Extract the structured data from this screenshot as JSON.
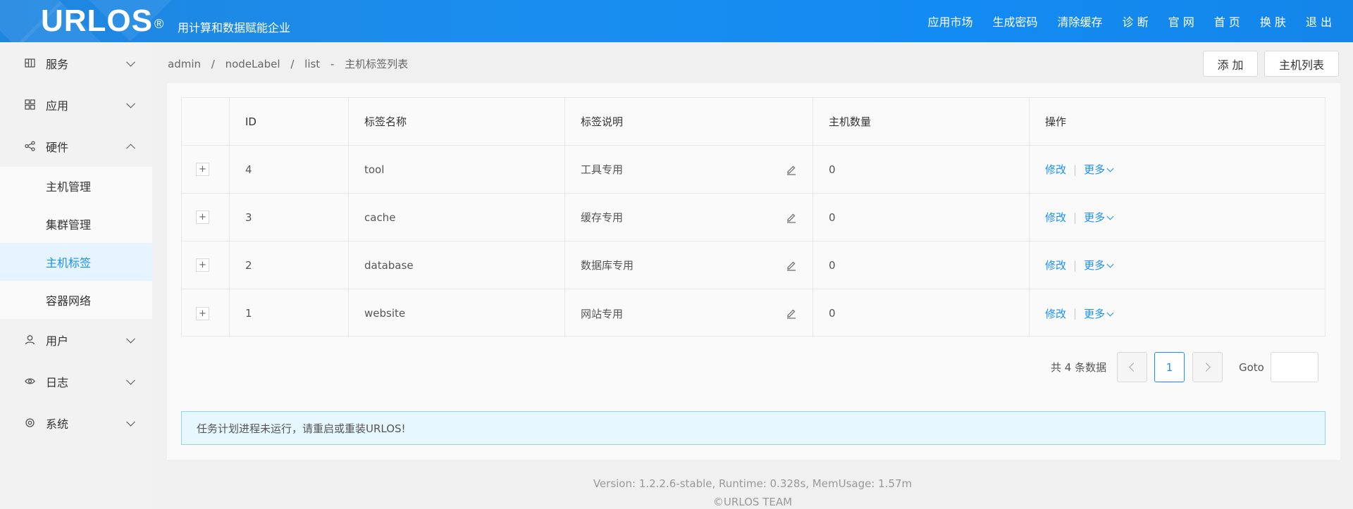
{
  "header": {
    "logo": "URLOS",
    "logo_mark": "®",
    "slogan": "用计算和数据赋能企业",
    "nav": [
      "应用市场",
      "生成密码",
      "清除缓存",
      "诊 断",
      "官 网",
      "首 页",
      "换 肤",
      "退 出"
    ]
  },
  "sidebar": {
    "items": [
      {
        "label": "服务",
        "icon": "grid-icon",
        "expanded": false
      },
      {
        "label": "应用",
        "icon": "apps-icon",
        "expanded": false
      },
      {
        "label": "硬件",
        "icon": "share-icon",
        "expanded": true
      },
      {
        "label": "用户",
        "icon": "user-icon",
        "expanded": false
      },
      {
        "label": "日志",
        "icon": "eye-icon",
        "expanded": false
      },
      {
        "label": "系统",
        "icon": "gear-icon",
        "expanded": false
      }
    ],
    "sub_items": [
      {
        "label": "主机管理",
        "active": false
      },
      {
        "label": "集群管理",
        "active": false
      },
      {
        "label": "主机标签",
        "active": true
      },
      {
        "label": "容器网络",
        "active": false
      }
    ]
  },
  "breadcrumb": {
    "parts": [
      "admin",
      "/",
      "nodeLabel",
      "/",
      "list",
      "-",
      "主机标签列表"
    ]
  },
  "toolbar": {
    "add_label": "添 加",
    "host_list_label": "主机列表"
  },
  "table": {
    "headers": [
      "",
      "ID",
      "标签名称",
      "标签说明",
      "主机数量",
      "操作"
    ],
    "rows": [
      {
        "expand": "+",
        "id": "4",
        "name": "tool",
        "desc": "工具专用",
        "count": "0"
      },
      {
        "expand": "+",
        "id": "3",
        "name": "cache",
        "desc": "缓存专用",
        "count": "0"
      },
      {
        "expand": "+",
        "id": "2",
        "name": "database",
        "desc": "数据库专用",
        "count": "0"
      },
      {
        "expand": "+",
        "id": "1",
        "name": "website",
        "desc": "网站专用",
        "count": "0"
      }
    ],
    "action_edit": "修改",
    "action_sep": "|",
    "action_more": "更多"
  },
  "pagination": {
    "total_text": "共 4 条数据",
    "current_page": "1",
    "goto_label": "Goto"
  },
  "alert": {
    "text": "任务计划进程未运行，请重启或重装URLOS!"
  },
  "footer": {
    "line1": "Version: 1.2.2.6-stable,   Runtime: 0.328s,   MemUsage: 1.57m",
    "line2": "©URLOS TEAM"
  },
  "colors": {
    "accent": "#1890ff",
    "header": "#1a8ef0",
    "alert_bg": "#e6f7ff"
  }
}
